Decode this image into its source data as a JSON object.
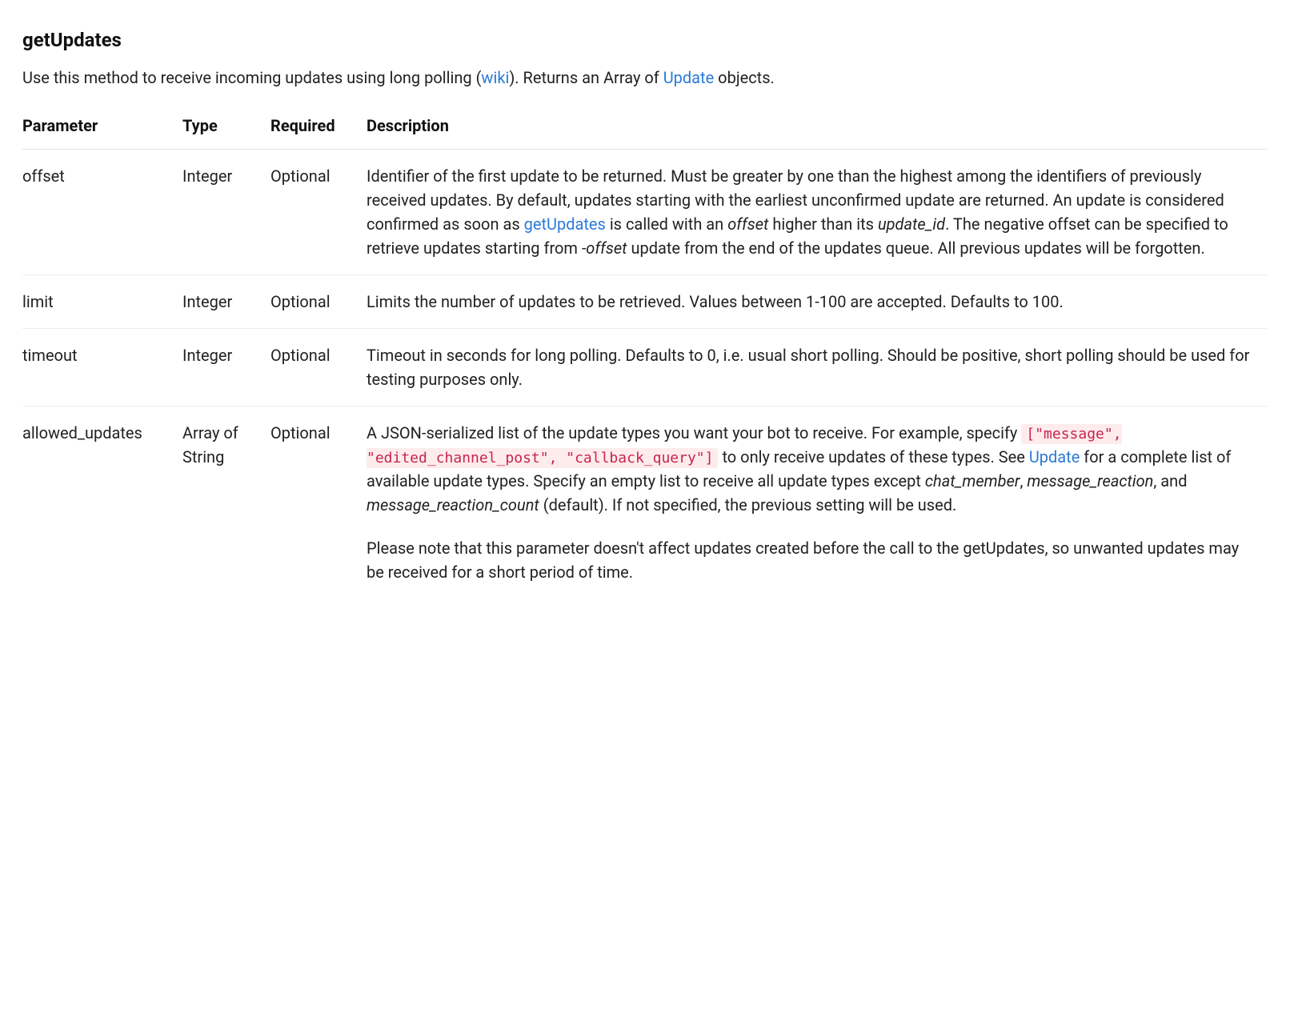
{
  "method": {
    "name": "getUpdates",
    "intro_pre": "Use this method to receive incoming updates using long polling (",
    "intro_link1": "wiki",
    "intro_mid": "). Returns an Array of ",
    "intro_link2": "Update",
    "intro_post": " objects."
  },
  "table": {
    "headers": {
      "parameter": "Parameter",
      "type": "Type",
      "required": "Required",
      "description": "Description"
    },
    "rows": {
      "offset": {
        "name": "offset",
        "type": "Integer",
        "required": "Optional",
        "d0": "Identifier of the first update to be returned. Must be greater by one than the highest among the identifiers of previously received updates. By default, updates starting with the earliest unconfirmed update are returned. An update is considered confirmed as soon as ",
        "d0_link": "getUpdates",
        "d0a": " is called with an ",
        "d0_em1": "offset",
        "d0b": " higher than its ",
        "d0_em2": "update_id",
        "d0c": ". The negative offset can be specified to retrieve updates starting from ",
        "d0_em3": "-offset",
        "d0d": " update from the end of the updates queue. All previous updates will be forgotten."
      },
      "limit": {
        "name": "limit",
        "type": "Integer",
        "required": "Optional",
        "desc": "Limits the number of updates to be retrieved. Values between 1-100 are accepted. Defaults to 100."
      },
      "timeout": {
        "name": "timeout",
        "type": "Integer",
        "required": "Optional",
        "desc": "Timeout in seconds for long polling. Defaults to 0, i.e. usual short polling. Should be positive, short polling should be used for testing purposes only."
      },
      "allowed_updates": {
        "name": "allowed_updates",
        "type": "Array of String",
        "required": "Optional",
        "d0": "A JSON-serialized list of the update types you want your bot to receive. For example, specify ",
        "d0_code": "[\"message\", \"edited_channel_post\", \"callback_query\"]",
        "d0a": " to only receive updates of these types. See ",
        "d0_link": "Update",
        "d0b": " for a complete list of available update types. Specify an empty list to receive all update types except ",
        "d0_em1": "chat_member",
        "d0c": ", ",
        "d0_em2": "message_reaction",
        "d0d": ", and ",
        "d0_em3": "message_reaction_count",
        "d0e": " (default). If not specified, the previous setting will be used.",
        "d1": "Please note that this parameter doesn't affect updates created before the call to the getUpdates, so unwanted updates may be received for a short period of time."
      }
    }
  }
}
